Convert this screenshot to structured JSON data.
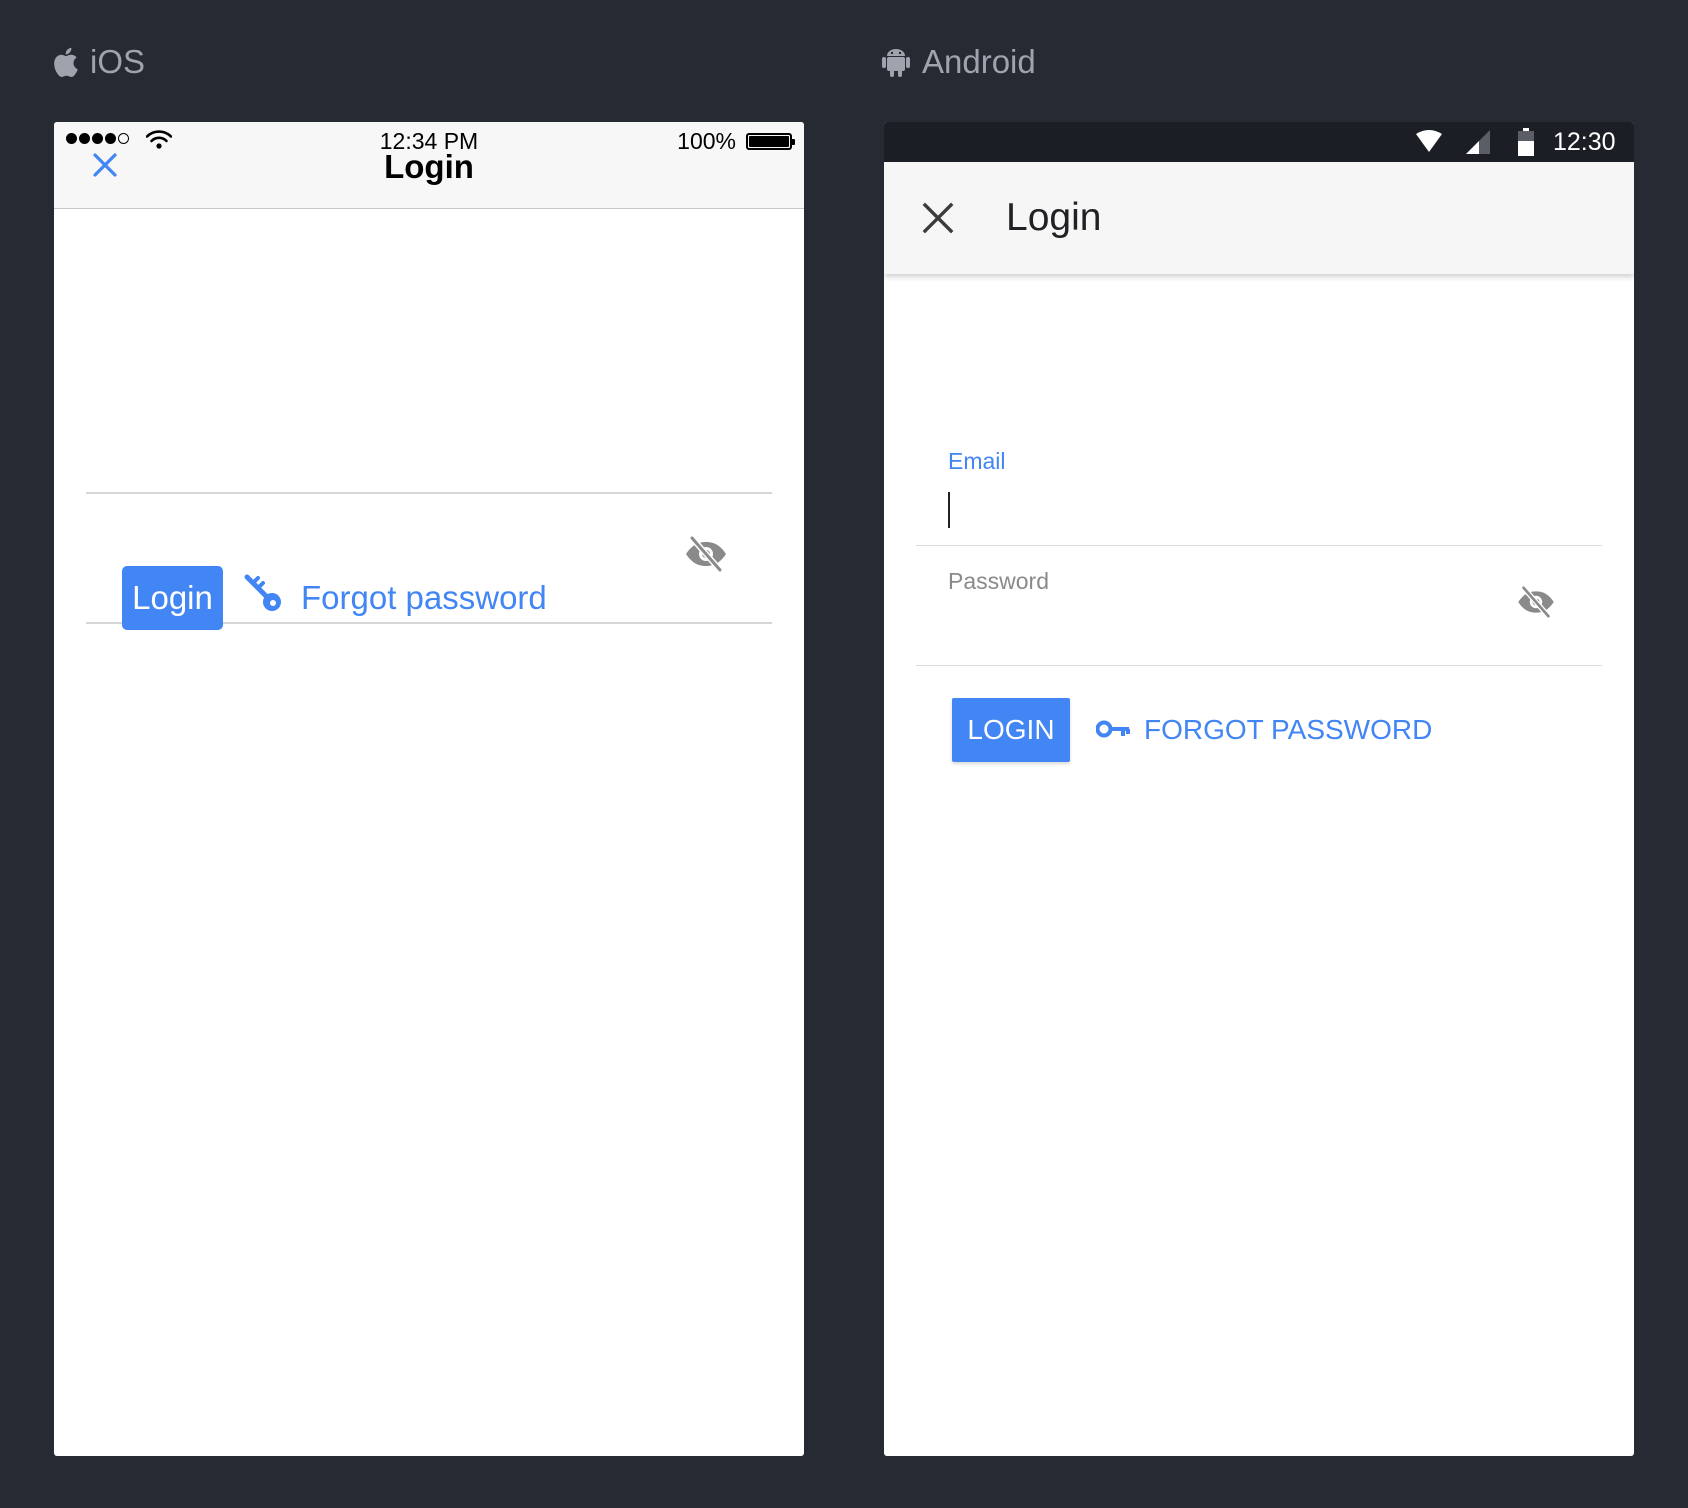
{
  "ios": {
    "platform_label": "iOS",
    "statusbar": {
      "time": "12:34 PM",
      "battery": "100%"
    },
    "title": "Login",
    "email": {
      "value": ""
    },
    "password": {
      "value": ""
    },
    "login_button": "Login",
    "forgot_password": "Forgot password"
  },
  "android": {
    "platform_label": "Android",
    "statusbar": {
      "time": "12:30"
    },
    "title": "Login",
    "email": {
      "label": "Email",
      "value": ""
    },
    "password": {
      "label": "Password",
      "value": ""
    },
    "login_button": "LOGIN",
    "forgot_password": "FORGOT PASSWORD"
  },
  "colors": {
    "accent": "#4285f4",
    "background": "#262a33",
    "platform_label": "#9ea3ad"
  }
}
